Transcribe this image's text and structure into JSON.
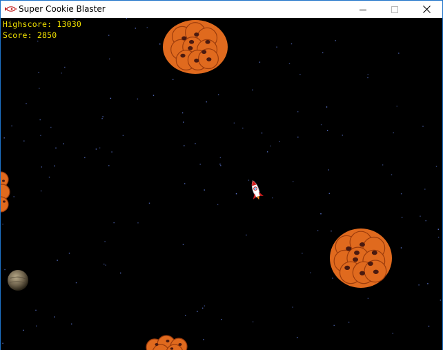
{
  "window": {
    "title": "Super Cookie Blaster",
    "icon": "rocket-icon",
    "controls": [
      "minimize-icon",
      "maximize-icon",
      "close-icon"
    ]
  },
  "hud": {
    "highscore_text": "Highscore: 13030",
    "score_text": "Score: 2850",
    "color": "#f2e200"
  },
  "game": {
    "background": "#000000",
    "star_color": "#5f7ad8",
    "cookie_color": "#e06a1e",
    "chip_color": "#4a1a10",
    "ship_colors": [
      "#ffffff",
      "#d41e1e"
    ]
  }
}
